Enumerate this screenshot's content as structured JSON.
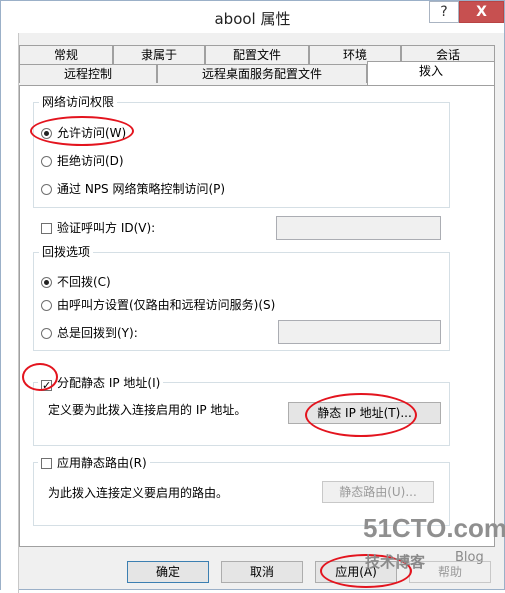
{
  "window": {
    "title": "abool 属性",
    "help_glyph": "?",
    "close_glyph": "X"
  },
  "tabs_row1": [
    "常规",
    "隶属于",
    "配置文件",
    "环境",
    "会话"
  ],
  "tabs_row2": [
    "远程控制",
    "远程桌面服务配置文件",
    "拨入"
  ],
  "network_access": {
    "label": "网络访问权限",
    "options": [
      "允许访问(W)",
      "拒绝访问(D)",
      "通过 NPS 网络策略控制访问(P)"
    ],
    "selected": 0
  },
  "verify_caller": {
    "label": "验证呼叫方 ID(V):",
    "checked": false
  },
  "callback": {
    "label": "回拨选项",
    "options": [
      "不回拨(C)",
      "由呼叫方设置(仅路由和远程访问服务)(S)",
      "总是回拨到(Y):"
    ],
    "selected": 0
  },
  "static_ip": {
    "label": "分配静态 IP 地址(I)",
    "checked": true,
    "description": "定义要为此拨入连接启用的 IP 地址。",
    "button": "静态 IP 地址(T)..."
  },
  "static_routes": {
    "label": "应用静态路由(R)",
    "checked": false,
    "description": "为此拨入连接定义要启用的路由。",
    "button": "静态路由(U)..."
  },
  "footer": {
    "ok": "确定",
    "cancel": "取消",
    "apply": "应用(A)",
    "help": "帮助"
  },
  "watermark": {
    "main": "51CTO.com",
    "sub": "技术博客",
    "blog": "Blog"
  },
  "colors": {
    "annotation": "#e3141e",
    "watermark": "#9a9a9a"
  }
}
